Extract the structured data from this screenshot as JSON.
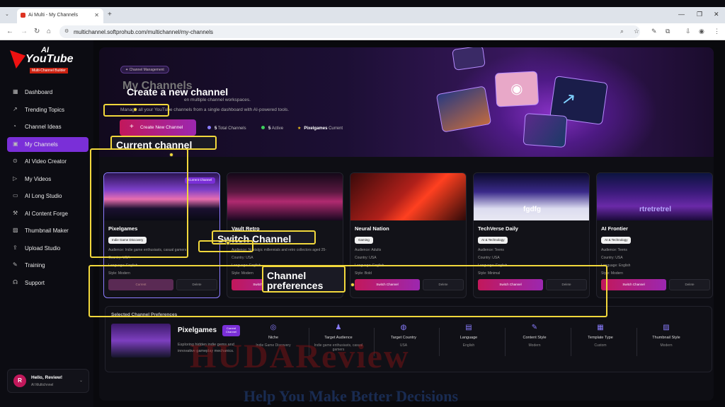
{
  "browser": {
    "tab_title": "Ai Multi - My Channels",
    "url": "multichannel.softprohub.com/multichannel/my-channels"
  },
  "logo": {
    "ai": "AI",
    "youtube": "YouTube",
    "subtitle": "Multi-Channel Builder"
  },
  "sidebar": {
    "items": [
      {
        "label": "Dashboard",
        "icon": "grid-icon",
        "glyph": "▦"
      },
      {
        "label": "Trending Topics",
        "icon": "trend-icon",
        "glyph": "↗"
      },
      {
        "label": "Channel Ideas",
        "icon": "idea-icon",
        "glyph": "◔"
      },
      {
        "label": "My Channels",
        "icon": "channels-icon",
        "glyph": "▣",
        "active": true
      },
      {
        "label": "AI Video Creator",
        "icon": "video-icon",
        "glyph": "⊙"
      },
      {
        "label": "My Videos",
        "icon": "play-icon",
        "glyph": "▷"
      },
      {
        "label": "AI Long Studio",
        "icon": "studio-icon",
        "glyph": "▭"
      },
      {
        "label": "AI Content Forge",
        "icon": "forge-icon",
        "glyph": "⚒"
      },
      {
        "label": "Thumbnail Maker",
        "icon": "image-icon",
        "glyph": "▨"
      },
      {
        "label": "Upload Studio",
        "icon": "upload-icon",
        "glyph": "⇪"
      },
      {
        "label": "Training",
        "icon": "training-icon",
        "glyph": "✎"
      },
      {
        "label": "Support",
        "icon": "support-icon",
        "glyph": "☊"
      }
    ]
  },
  "user": {
    "initial": "R",
    "greeting": "Hello, Review!",
    "subtitle": "AI Multichnnel"
  },
  "hero": {
    "pill": "Channel Management",
    "title": "My Channels",
    "subtitle_a": "en multiple channel workspaces.",
    "subtitle_b": "Manage all your YouTube channels from a single dashboard with AI-powered tools.",
    "new_button": "Create New Channel",
    "total": "5",
    "total_label": "Total Channels",
    "active": "5",
    "active_label": "Active",
    "current": "Pixelgames",
    "current_label": "Current",
    "current_hint": "ent"
  },
  "channels": [
    {
      "name": "Pixelgames",
      "tag": "Indie Game Discovery",
      "audience": "Audience: Indie game enthusiasts, casual gamers",
      "country": "Country: USA",
      "language": "Language: English",
      "style": "Style: Modern",
      "primary": "Current",
      "delete": "Delete",
      "badge": "Current Channel",
      "current": true
    },
    {
      "name": "Vault Retro",
      "tag": "",
      "audience": "Audience: Nostalgic millennials and retro collectors aged 25-",
      "country": "Country: USA",
      "language": "Language: English",
      "style": "Style: Modern",
      "primary": "Switch Channel",
      "delete": "Delete"
    },
    {
      "name": "Neural Nation",
      "tag": "Gaming",
      "audience": "Audience: Adults",
      "country": "Country: USA",
      "language": "Language: English",
      "style": "Style: Bold",
      "primary": "Switch Channel",
      "delete": "Delete"
    },
    {
      "name": "TechVerse Daily",
      "tag": "AI & Technology",
      "audience": "Audience: Teens",
      "country": "Country: USA",
      "language": "Language: English",
      "style": "Style: Minimal",
      "primary": "Switch Channel",
      "delete": "Delete",
      "thumb_text": "fgdfg"
    },
    {
      "name": "AI Frontier",
      "tag": "AI & Technology",
      "audience": "Audience: Teens",
      "country": "Country: USA",
      "language": "Language: English",
      "style": "Style: Modern",
      "primary": "Switch Channel",
      "delete": "Delete",
      "thumb_text": "rtretretrel"
    }
  ],
  "preferences": {
    "title": "Selected Channel Preferences",
    "name": "Pixelgames",
    "badge": "Current Channel",
    "desc": "Exploring hidden indie gems and innovative gameplay mechanics.",
    "cols": [
      {
        "label": "Niche",
        "value": "Indie Game Discovery",
        "icon": "target-icon",
        "glyph": "◎"
      },
      {
        "label": "Target Audience",
        "value": "Indie game enthusiasts, casual gamers",
        "icon": "users-icon",
        "glyph": "♟"
      },
      {
        "label": "Target Country",
        "value": "USA",
        "icon": "globe-icon",
        "glyph": "◍"
      },
      {
        "label": "Language",
        "value": "English",
        "icon": "language-icon",
        "glyph": "▤"
      },
      {
        "label": "Content Style",
        "value": "Modern",
        "icon": "brush-icon",
        "glyph": "✎"
      },
      {
        "label": "Template Type",
        "value": "Custom",
        "icon": "template-icon",
        "glyph": "▦"
      },
      {
        "label": "Thumbnail Style",
        "value": "Modern",
        "icon": "thumbnail-icon",
        "glyph": "▨"
      }
    ]
  },
  "annotations": {
    "create": "Create a new channel",
    "current": "Current channel",
    "switch": "Switch Channel",
    "prefs_1": "Channel",
    "prefs_2": "preferences"
  },
  "watermark": {
    "big": "HUDAReview",
    "small": "Help You Make Better Decisions"
  }
}
